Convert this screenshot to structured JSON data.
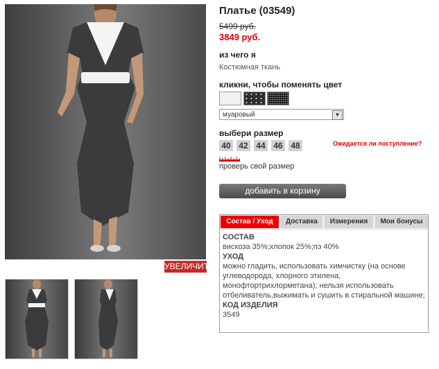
{
  "product": {
    "title": "Платье (03549)",
    "old_price": "5499 руб.",
    "new_price": "3849 руб."
  },
  "gallery": {
    "zoom_label": "УВЕЛИЧИТЬ"
  },
  "material": {
    "label": "из чего я",
    "value": "Костюмная ткань"
  },
  "color": {
    "label": "кликни, чтобы поменять цвет",
    "selected": "муаровый"
  },
  "size": {
    "label": "выбери размер",
    "options": [
      "40",
      "42",
      "44",
      "46",
      "48"
    ],
    "availability_link": "Ожидается ли поступление?",
    "check_size": "проверь свой размер"
  },
  "cart": {
    "button_label": "добавить в корзину"
  },
  "tabs": {
    "items": [
      "Состав / Уход",
      "Доставка",
      "Измерения",
      "Мои бонусы"
    ],
    "active_index": 0,
    "content": {
      "composition_heading": "СОСТАВ",
      "composition": "вискоза 35%;хлопок 25%;пэ 40%",
      "care_heading": "УХОД",
      "care": "можно гладить, использовать химчистку (на основе углеводорода, хлорного этилена, монофтортрихлорметана); нельзя использовать отбеливатель,выжимать и сушить в стиральной машине;",
      "code_heading": "КОД ИЗДЕЛИЯ",
      "code": "3549"
    }
  },
  "colors": {
    "accent_red": "#d00000",
    "button_gray": "#5a5a5a"
  }
}
